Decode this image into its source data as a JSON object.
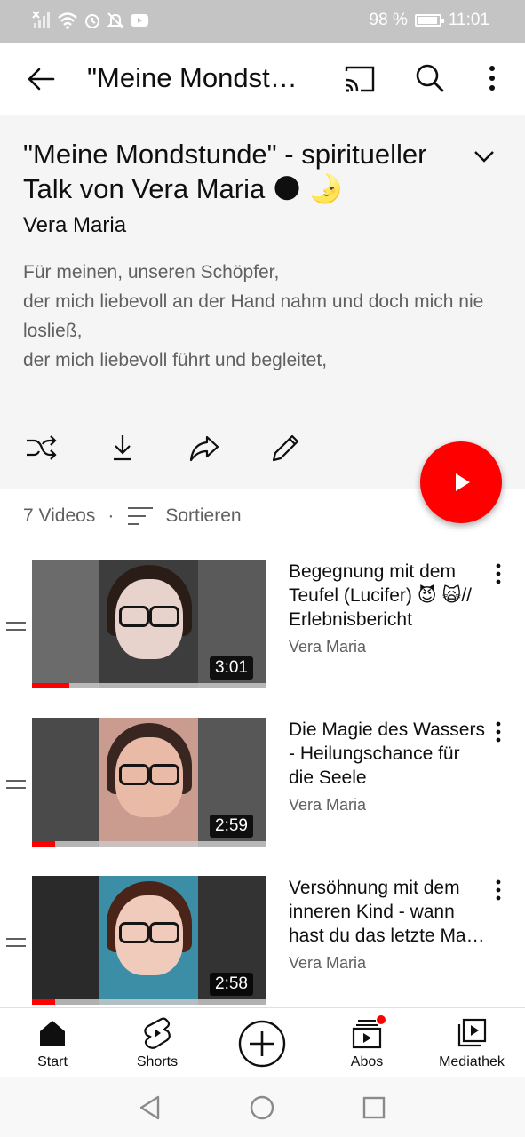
{
  "status_bar": {
    "battery": "98 %",
    "time": "11:01"
  },
  "app_bar": {
    "title": "\"Meine Mondstunde\" - spiritueller Talk von Vera Maria",
    "icons": [
      "back-arrow-icon",
      "cast-icon",
      "search-icon",
      "more-vert-icon"
    ]
  },
  "playlist": {
    "title": "\"Meine Mondstunde\" - spiritueller Talk von Vera Maria 🌑 🌛",
    "owner": "Vera Maria",
    "description": [
      "Für meinen, unseren Schöpfer,",
      "der mich liebevoll an der Hand nahm und doch mich nie losließ,",
      "der mich liebevoll führt und begleitet,"
    ],
    "actions": [
      "shuffle-icon",
      "download-icon",
      "share-icon",
      "edit-icon"
    ],
    "play_all_icon": "play-icon",
    "video_count": "7 Videos",
    "separator": "·",
    "sort_label": "Sortieren"
  },
  "videos": [
    {
      "title": "Begegnung mit dem Teufel (Lucifer) 😈 🙀// Erlebnisbericht",
      "channel": "Vera Maria",
      "duration": "3:01",
      "progress": 0.16,
      "colors": {
        "left": "#6b6b6b",
        "center": "#3d3d3d",
        "right": "#5a5a5a",
        "face": "#e7d2cc"
      }
    },
    {
      "title": "Die Magie des Wassers - Heilungschance für die Seele",
      "channel": "Vera Maria",
      "duration": "2:59",
      "progress": 0.1,
      "colors": {
        "left": "#4a4a4a",
        "center": "#c99c8f",
        "right": "#575757",
        "face": "#e9bba7"
      }
    },
    {
      "title": "Versöhnung mit dem inneren Kind - wann hast du das letzte Mal mit ihm gesprochen?",
      "channel": "Vera Maria",
      "duration": "2:58",
      "progress": 0.1,
      "colors": {
        "left": "#2a2a2a",
        "center": "#3b8ea6",
        "right": "#333333",
        "face": "#f0cbbb"
      }
    }
  ],
  "bottom_nav": [
    {
      "label": "Start",
      "icon": "home-icon"
    },
    {
      "label": "Shorts",
      "icon": "shorts-icon"
    },
    {
      "label": "",
      "icon": "create-plus-icon"
    },
    {
      "label": "Abos",
      "icon": "subscriptions-icon"
    },
    {
      "label": "Mediathek",
      "icon": "library-icon"
    }
  ],
  "system_nav": [
    "back-triangle-icon",
    "home-circle-icon",
    "recents-square-icon"
  ],
  "colors": {
    "accent": "#ff0000",
    "header_bg": "#f5f5f5",
    "secondary_text": "#606060"
  }
}
